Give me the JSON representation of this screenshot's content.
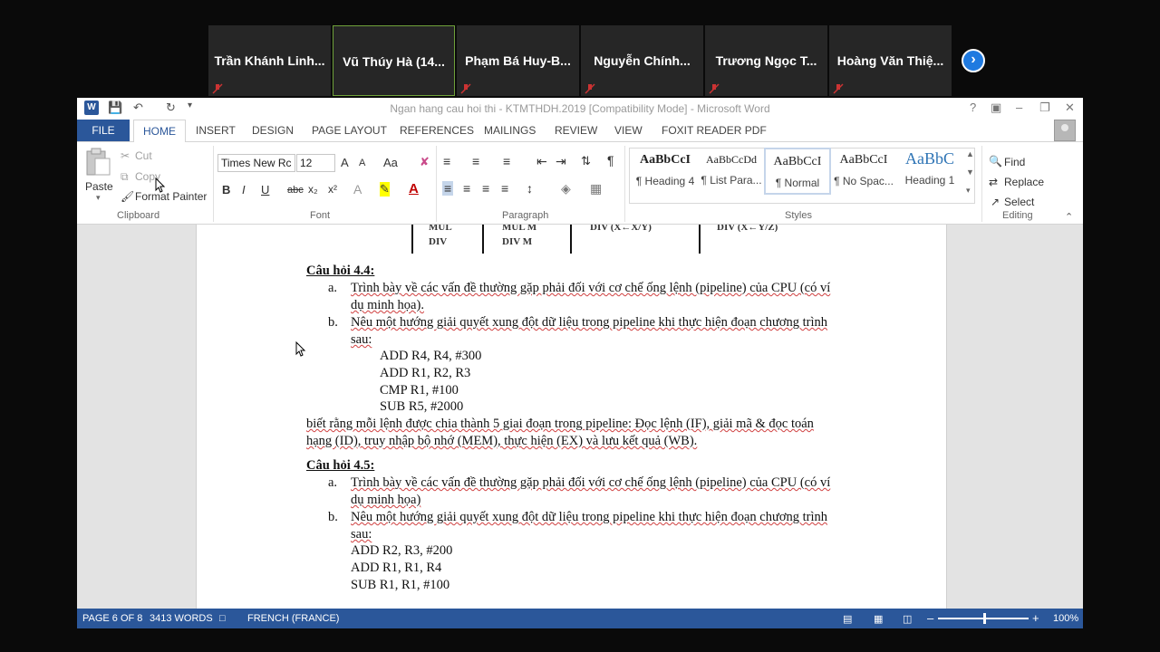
{
  "meeting": {
    "participants": [
      {
        "name": "Trần Khánh Linh..."
      },
      {
        "name": "Vũ Thúy Hà (14..."
      },
      {
        "name": "Phạm Bá Huy-B..."
      },
      {
        "name": "Nguyễn Chính..."
      },
      {
        "name": "Trương Ngọc T..."
      },
      {
        "name": "Hoàng Văn Thiệ..."
      }
    ],
    "next_icon": "chevron-right-icon"
  },
  "window": {
    "title": "Ngan hang cau hoi thi - KTMTHDH.2019 [Compatibility Mode] - Microsoft Word",
    "app_icon": "W"
  },
  "tabs": {
    "file": "FILE",
    "home": "HOME",
    "insert": "INSERT",
    "design": "DESIGN",
    "page_layout": "PAGE LAYOUT",
    "references": "REFERENCES",
    "mailings": "MAILINGS",
    "review": "REVIEW",
    "view": "VIEW",
    "foxit": "FOXIT READER PDF"
  },
  "ribbon": {
    "clipboard": {
      "paste": "Paste",
      "cut": "Cut",
      "copy": "Copy",
      "format_painter": "Format Painter",
      "label": "Clipboard"
    },
    "font": {
      "family": "Times New Rc",
      "size": "12",
      "label": "Font",
      "bold": "B",
      "italic": "I",
      "underline": "U",
      "strike": "abc",
      "sub": "x₂",
      "sup": "x²",
      "grow": "A",
      "shrink": "A",
      "case": "Aa"
    },
    "paragraph": {
      "label": "Paragraph"
    },
    "styles": {
      "label": "Styles",
      "items": [
        {
          "sample": "AaBbCcI",
          "name": "¶ Heading 4"
        },
        {
          "sample": "AaBbCcDd",
          "name": "¶ List Para..."
        },
        {
          "sample": "AaBbCcI",
          "name": "¶ Normal"
        },
        {
          "sample": "AaBbCcI",
          "name": "¶ No Spac..."
        },
        {
          "sample": "AaBbC",
          "name": "Heading 1"
        }
      ]
    },
    "editing": {
      "find": "Find",
      "replace": "Replace",
      "select": "Select",
      "label": "Editing"
    }
  },
  "document": {
    "table_fragment": {
      "c1": "MUL",
      "c1b": "DIV",
      "c2": "MUL M",
      "c2b": "DIV M",
      "c3": "DIV (X←X/Y)",
      "c4": "DIV (X←Y/Z)"
    },
    "q44": {
      "heading": "Câu hỏi 4.4:",
      "a_marker": "a.",
      "a_line1": "Trình bày về các vấn đề thường gặp phải đối với cơ chế ống lệnh (pipeline) của CPU (có ví",
      "a_line2": "dụ minh họa).",
      "b_marker": "b.",
      "b_line1": "Nêu một hướng giải quyết xung đột dữ liệu trong pipeline khi thực hiện đoạn chương trình",
      "b_line2": "sau:",
      "code": [
        "ADD R4, R4, #300",
        "ADD R1, R2, R3",
        "CMP R1, #100",
        "SUB  R5, #2000"
      ],
      "after1": "biết rằng mỗi lệnh được chia thành 5 giai đoạn trong pipeline: Đọc lệnh (IF), giải mã & đọc toán",
      "after2": "hạng (ID), truy nhập bộ nhớ (MEM), thực hiện (EX) và lưu kết quả (WB)."
    },
    "q45": {
      "heading": "Câu hỏi 4.5:",
      "a_marker": "a.",
      "a_line1": "Trình bày về các vấn đề thường gặp phải đối với cơ chế ống lệnh (pipeline) của CPU (có ví",
      "a_line2": "dụ minh họa)",
      "b_marker": "b.",
      "b_line1": "Nêu một hướng giải quyết xung đột dữ liệu trong pipeline khi thực hiện đoạn chương trình",
      "b_line2": "sau:",
      "code": [
        "ADD R2, R3, #200",
        "ADD R1, R1, R4",
        "SUB R1, R1, #100"
      ]
    }
  },
  "status": {
    "page": "PAGE 6 OF 8",
    "words": "3413 WORDS",
    "language": "FRENCH (FRANCE)",
    "zoom": "100%",
    "zoom_level": 100
  },
  "colors": {
    "word_blue": "#2b579a",
    "meet_blue": "#1f7ae0",
    "active_border": "#6fa13a"
  }
}
